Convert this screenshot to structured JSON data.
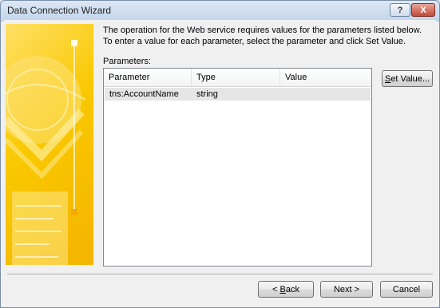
{
  "window": {
    "title": "Data Connection Wizard",
    "help_glyph": "?",
    "close_glyph": "X"
  },
  "description": {
    "line1": "The operation for the Web service requires values for the parameters listed below.",
    "line2": "To enter a value for each parameter, select the parameter and click Set Value."
  },
  "parameters": {
    "label": "Parameters:",
    "columns": [
      "Parameter",
      "Type",
      "Value"
    ],
    "rows": [
      {
        "parameter": "tns:AccountName",
        "type": "string",
        "value": ""
      }
    ],
    "set_value_button": {
      "mnemonic": "S",
      "rest": "et Value..."
    }
  },
  "footer": {
    "back": {
      "prefix": "< ",
      "mnemonic": "B",
      "rest": "ack"
    },
    "next": "Next >",
    "cancel": "Cancel"
  },
  "colors": {
    "banner_yellow": "#f9c800",
    "accent_orange": "#f4b400"
  }
}
